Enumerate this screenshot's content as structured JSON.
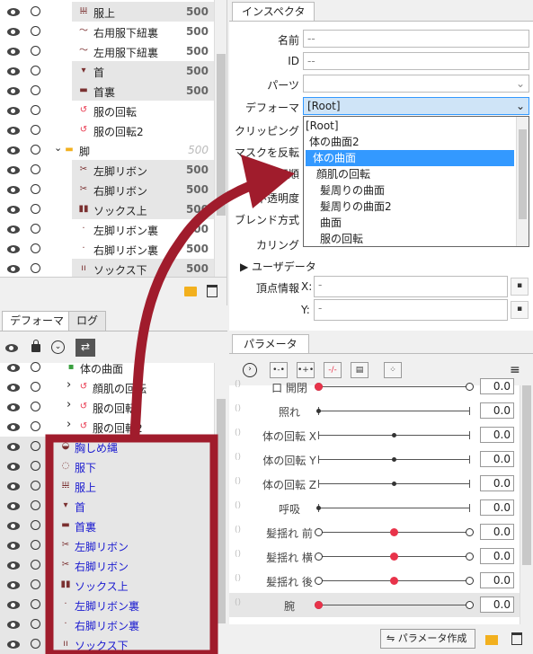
{
  "parts_panel": {
    "rows": [
      {
        "label": "服上",
        "value": "500",
        "icon": "cloth-icon"
      },
      {
        "label": "右用服下紐裏",
        "value": "500",
        "icon": "string-icon"
      },
      {
        "label": "左用服下紐裏",
        "value": "500",
        "icon": "string-icon"
      },
      {
        "label": "首",
        "value": "500",
        "icon": "neck-icon"
      },
      {
        "label": "首裏",
        "value": "500",
        "icon": "neck-back-icon"
      },
      {
        "label": "服の回転",
        "value": "",
        "icon": "rotation-icon"
      },
      {
        "label": "服の回転2",
        "value": "",
        "icon": "rotation-icon"
      },
      {
        "label": "脚",
        "value": "500",
        "icon": "folder-icon"
      },
      {
        "label": "左脚リボン",
        "value": "500",
        "icon": "ribbon-icon"
      },
      {
        "label": "右脚リボン",
        "value": "500",
        "icon": "ribbon-icon"
      },
      {
        "label": "ソックス上",
        "value": "500",
        "icon": "sock-icon"
      },
      {
        "label": "左脚リボン裏",
        "value": "500",
        "icon": "ribbon-back-icon"
      },
      {
        "label": "右脚リボン裏",
        "value": "500",
        "icon": "ribbon-back-icon"
      },
      {
        "label": "ソックス下",
        "value": "500",
        "icon": "sock-lower-icon"
      }
    ]
  },
  "deformer_panel": {
    "tabs": [
      "デフォーマ",
      "ログ"
    ],
    "rows": [
      {
        "label": "体の曲面",
        "icon": "curve-icon"
      },
      {
        "label": "顔肌の回転",
        "icon": "rotation-icon"
      },
      {
        "label": "服の回転",
        "icon": "rotation-icon"
      },
      {
        "label": "服の回転2",
        "icon": "rotation-icon"
      },
      {
        "label": "胸しめ縄",
        "icon": "rope-icon"
      },
      {
        "label": "服下",
        "icon": "cloth-lower-icon"
      },
      {
        "label": "服上",
        "icon": "cloth-icon"
      },
      {
        "label": "首",
        "icon": "neck-icon"
      },
      {
        "label": "首裏",
        "icon": "neck-back-icon"
      },
      {
        "label": "左脚リボン",
        "icon": "ribbon-icon"
      },
      {
        "label": "右脚リボン",
        "icon": "ribbon-icon"
      },
      {
        "label": "ソックス上",
        "icon": "sock-icon"
      },
      {
        "label": "左脚リボン裏",
        "icon": "ribbon-back-icon"
      },
      {
        "label": "右脚リボン裏",
        "icon": "ribbon-back-icon"
      },
      {
        "label": "ソックス下",
        "icon": "sock-lower-icon"
      }
    ]
  },
  "inspector": {
    "tab": "インスペクタ",
    "name_label": "名前",
    "name_value": "--",
    "id_label": "ID",
    "id_value": "--",
    "parts_label": "パーツ",
    "deformer_label": "デフォーマ",
    "deformer_value": "[Root]",
    "clipping_label": "クリッピング",
    "mask_label": "マスクを反転",
    "order_label": "描画順",
    "opacity_label": "不透明度",
    "blend_label": "ブレンド方式",
    "culling_label": "カリング",
    "userdata_label": "ユーザデータ",
    "vertex_label": "頂点情報",
    "x_label": "X:",
    "x_value": "-",
    "y_label": "Y:",
    "y_value": "-",
    "dropdown_items": [
      "[Root]",
      "体の曲面2",
      "体の曲面",
      "顔肌の回転",
      "髪周りの曲面",
      "髪周りの曲面2",
      "曲面",
      "服の回転"
    ],
    "dropdown_selected": 2
  },
  "parameter_panel": {
    "tab": "パラメータ",
    "create_button": "パラメータ作成",
    "params": [
      {
        "label": "口 開閉",
        "value": "0.0",
        "pos": 0.0,
        "type": "end"
      },
      {
        "label": "照れ",
        "value": "0.0",
        "pos": 0.0,
        "type": "plain"
      },
      {
        "label": "体の回転 X",
        "value": "0.0",
        "pos": 0.5,
        "type": "plain"
      },
      {
        "label": "体の回転 Y",
        "value": "0.0",
        "pos": 0.5,
        "type": "plain"
      },
      {
        "label": "体の回転 Z",
        "value": "0.0",
        "pos": 0.5,
        "type": "plain"
      },
      {
        "label": "呼吸",
        "value": "0.0",
        "pos": 0.0,
        "type": "plain"
      },
      {
        "label": "髪揺れ 前",
        "value": "0.0",
        "pos": 0.5,
        "type": "three"
      },
      {
        "label": "髪揺れ 横",
        "value": "0.0",
        "pos": 0.5,
        "type": "three"
      },
      {
        "label": "髪揺れ 後",
        "value": "0.0",
        "pos": 0.5,
        "type": "three"
      },
      {
        "label": "腕",
        "value": "0.0",
        "pos": 0.0,
        "type": "end"
      }
    ]
  },
  "colors": {
    "accent": "#3399ff",
    "highlight_red": "#e8334a",
    "annotation": "#a01c2c"
  }
}
